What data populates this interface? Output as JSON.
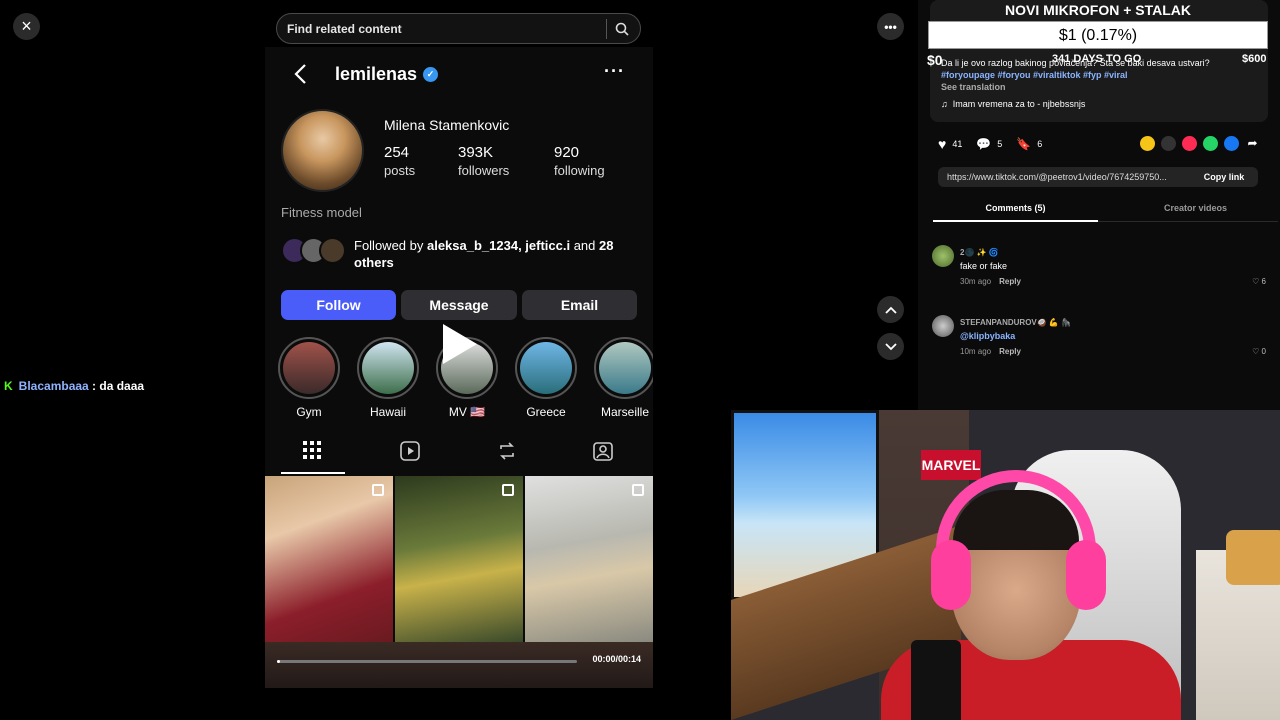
{
  "viewer": {
    "close_icon": "×",
    "search_placeholder": "Find related content",
    "more_icon": "•••",
    "up_icon": "˄",
    "down_icon": "˅"
  },
  "instagram": {
    "username": "lemilenas",
    "display_name": "Milena Stamenkovic",
    "stats": [
      {
        "value": "254",
        "label": "posts"
      },
      {
        "value": "393K",
        "label": "followers"
      },
      {
        "value": "920",
        "label": "following"
      }
    ],
    "bio": "Fitness model",
    "followed_by_prefix": "Followed by ",
    "followed_by_users": "aleksa_b_1234, jefticc.i",
    "followed_by_and": " and ",
    "followed_by_others": "28 others",
    "buttons": {
      "follow": "Follow",
      "message": "Message",
      "email": "Email"
    },
    "highlights": [
      "Gym",
      "Hawaii",
      "MV 🇺🇸",
      "Greece",
      "Marseille"
    ],
    "video_time": "00:00/00:14",
    "progress_fraction": 0.01
  },
  "tiktok": {
    "description": "Da li je ovo razlog bakinog povlačenja? Šta se baki desava ustvari?",
    "hashtags": "#foryoupage #foryou #viraltiktok #fyp #viral",
    "see_translation": "See translation",
    "music": "Imam vremena za to - njbebssnjs",
    "likes": "41",
    "comments_count": "5",
    "saves": "6",
    "url": "https://www.tiktok.com/@peetrov1/video/7674259750...",
    "copy_link": "Copy link",
    "tab_comments": "Comments (5)",
    "tab_creator": "Creator videos",
    "comments": [
      {
        "user": "2🌑 ✨ 🌀",
        "text": "fake or fake",
        "time": "30m ago",
        "reply": "Reply",
        "likes": "6"
      },
      {
        "user": "STEFANPANDUROV🥥 💪 🦍",
        "text": "@klipbybaka",
        "time": "10m ago",
        "reply": "Reply",
        "likes": "0"
      }
    ]
  },
  "donation": {
    "title": "NOVI MIKROFON + STALAK",
    "amount": "$1 (0.17%)",
    "start": "$0",
    "days_left": "341 DAYS TO GO",
    "goal": "$600"
  },
  "chat": {
    "badge": "K",
    "user": "Blacambaaa",
    "message": " : da daaa"
  },
  "webcam": {
    "sign": "MARVEL"
  }
}
